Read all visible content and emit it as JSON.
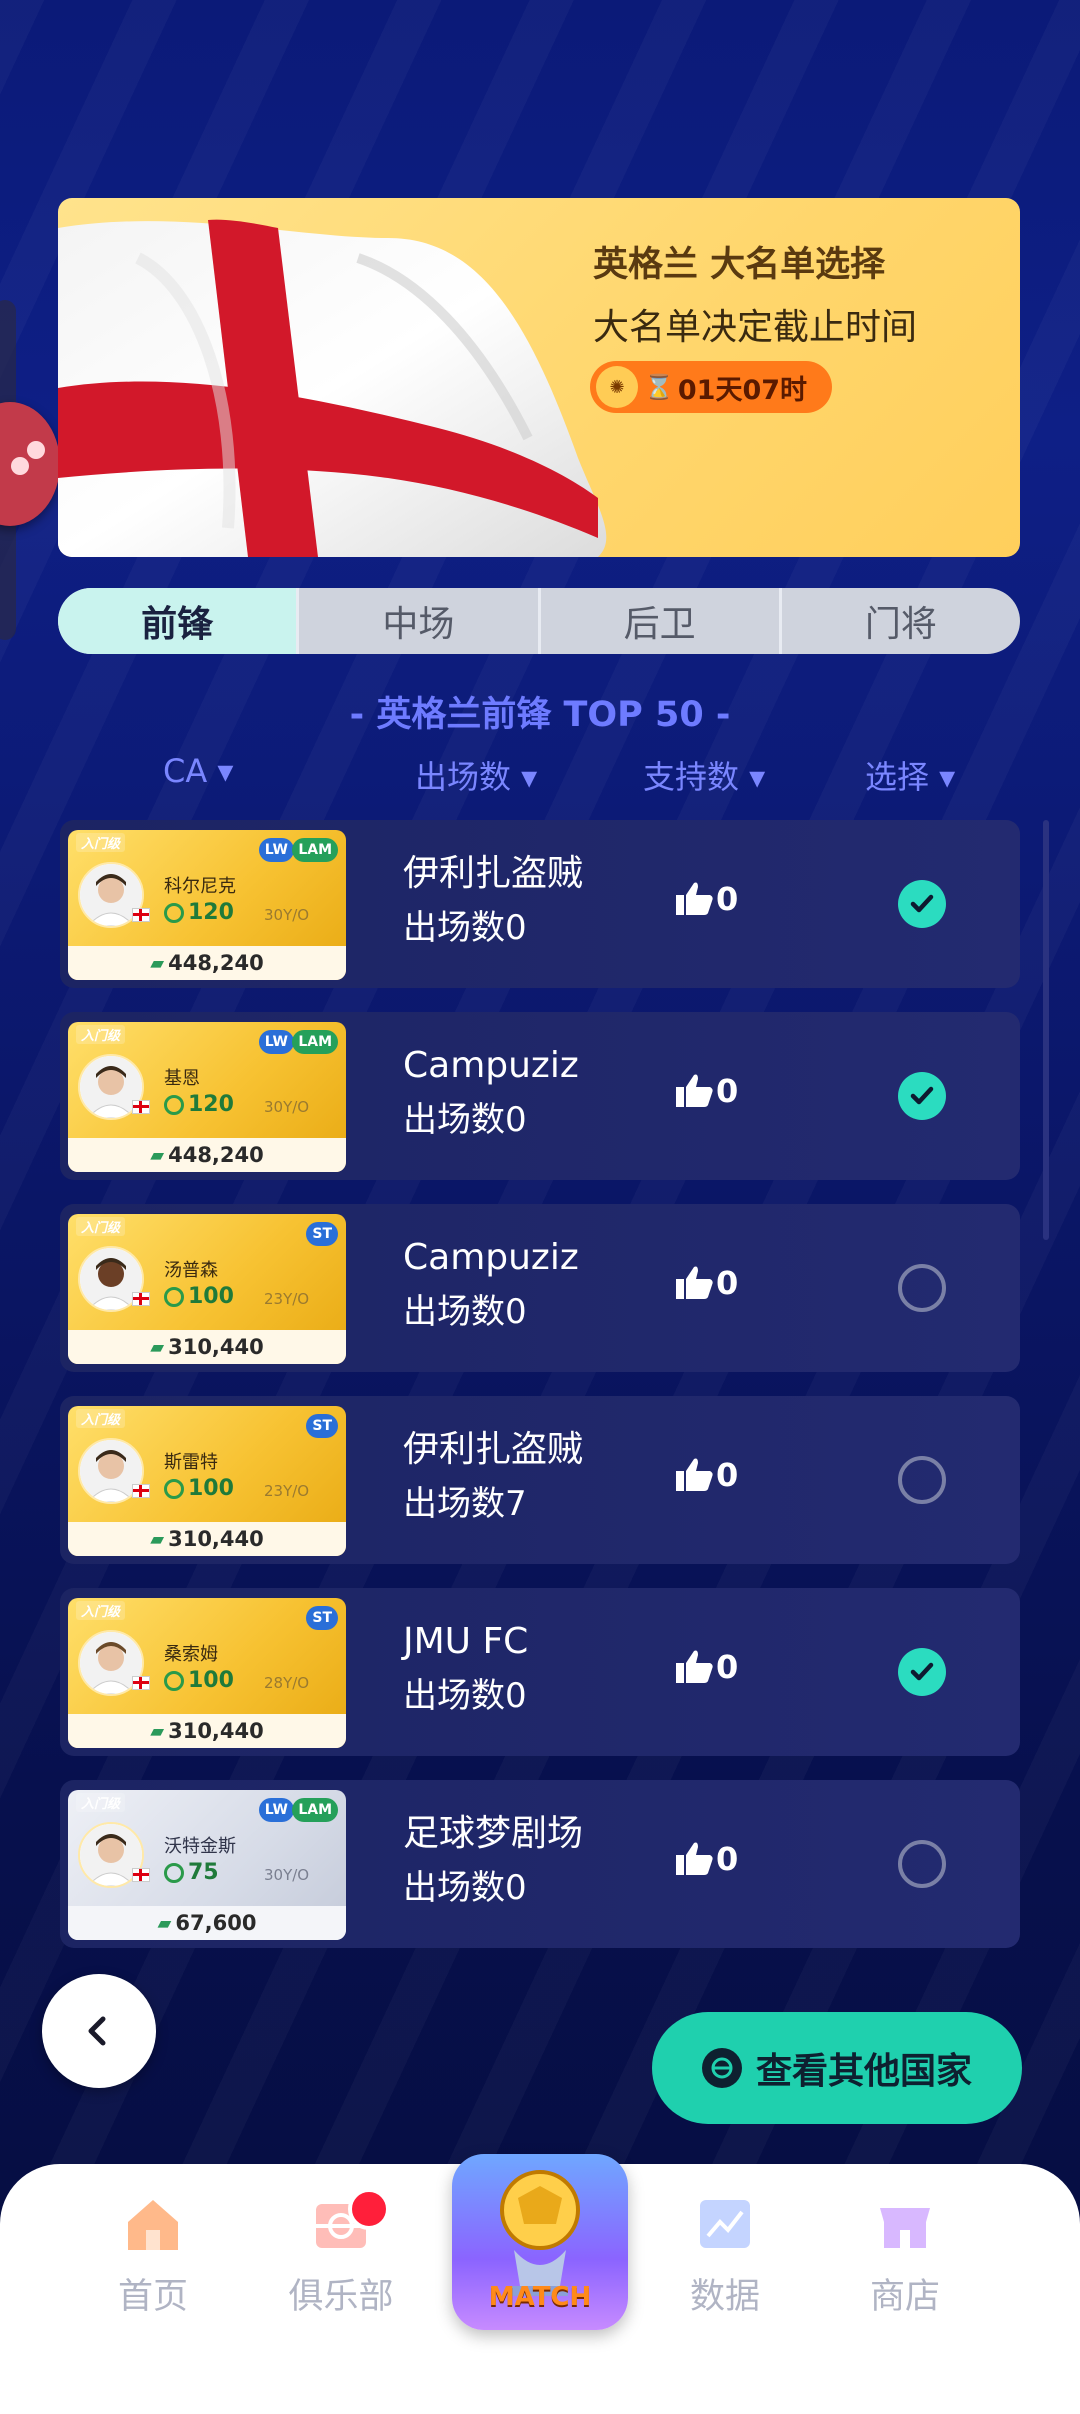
{
  "banner": {
    "title": "英格兰 大名单选择",
    "subtitle": "大名单决定截止时间",
    "countdown": "01天07时"
  },
  "tabs": [
    "前锋",
    "中场",
    "后卫",
    "门将"
  ],
  "active_tab": "前锋",
  "list_title": "- 英格兰前锋 TOP 50 -",
  "columns": {
    "ca": "CA ▾",
    "apps": "出场数 ▾",
    "support": "支持数 ▾",
    "select": "选择 ▾"
  },
  "players": [
    {
      "tier": "入门级",
      "name": "科尔尼克",
      "rating": "120",
      "age": "30Y/O",
      "value": "448,240",
      "positions": [
        "LW",
        "LAM"
      ],
      "club": "伊利扎盗贼",
      "apps": "出场数0",
      "likes": "0",
      "selected": true,
      "card": "gold"
    },
    {
      "tier": "入门级",
      "name": "基恩",
      "rating": "120",
      "age": "30Y/O",
      "value": "448,240",
      "positions": [
        "LW",
        "LAM"
      ],
      "club": "Campuziz",
      "apps": "出场数0",
      "likes": "0",
      "selected": true,
      "card": "gold"
    },
    {
      "tier": "入门级",
      "name": "汤普森",
      "rating": "100",
      "age": "23Y/O",
      "value": "310,440",
      "positions": [
        "ST"
      ],
      "club": "Campuziz",
      "apps": "出场数0",
      "likes": "0",
      "selected": false,
      "card": "gold"
    },
    {
      "tier": "入门级",
      "name": "斯雷特",
      "rating": "100",
      "age": "23Y/O",
      "value": "310,440",
      "positions": [
        "ST"
      ],
      "club": "伊利扎盗贼",
      "apps": "出场数7",
      "likes": "0",
      "selected": false,
      "card": "gold"
    },
    {
      "tier": "入门级",
      "name": "桑索姆",
      "rating": "100",
      "age": "28Y/O",
      "value": "310,440",
      "positions": [
        "ST"
      ],
      "club": "JMU FC",
      "apps": "出场数0",
      "likes": "0",
      "selected": true,
      "card": "gold"
    },
    {
      "tier": "入门级",
      "name": "沃特金斯",
      "rating": "75",
      "age": "30Y/O",
      "value": "67,600",
      "positions": [
        "LW",
        "LAM"
      ],
      "club": "足球梦剧场",
      "apps": "出场数0",
      "likes": "0",
      "selected": false,
      "card": "silver"
    }
  ],
  "other_countries_button": "查看其他国家",
  "nav": {
    "home": "首页",
    "club": "俱乐部",
    "match": "MATCH",
    "data": "数据",
    "shop": "商店"
  },
  "colors": {
    "accent": "#1fd0ae",
    "check_on": "#2bdcc0",
    "tab_active": "#c9f3ee",
    "list_title": "#6e7bff"
  },
  "icons": [
    "hourglass-icon",
    "thumbs-up-icon",
    "check-icon",
    "back-arrow-icon",
    "globe-icon",
    "home-icon",
    "club-icon",
    "chart-icon",
    "shop-icon"
  ]
}
